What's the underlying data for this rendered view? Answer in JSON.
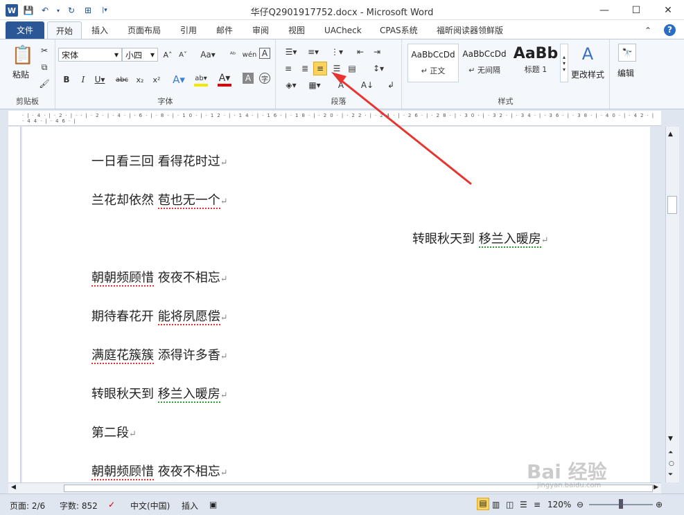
{
  "window": {
    "title": "华仔Q2901917752.docx - Microsoft Word",
    "app_icon_letter": "W"
  },
  "tabs": [
    "文件",
    "开始",
    "插入",
    "页面布局",
    "引用",
    "邮件",
    "审阅",
    "视图",
    "UACheck",
    "CPAS系统",
    "福昕阅读器领鲜版"
  ],
  "active_tab": "开始",
  "ribbon": {
    "clipboard": {
      "label": "剪贴板",
      "paste": "粘贴"
    },
    "font": {
      "label": "字体",
      "font_name": "宋体",
      "font_size": "小四"
    },
    "paragraph": {
      "label": "段落",
      "selected": "align-right"
    },
    "styles": {
      "label": "样式",
      "items": [
        {
          "preview": "AaBbCcDd",
          "name": "↵ 正文"
        },
        {
          "preview": "AaBbCcDd",
          "name": "↵ 无间隔"
        },
        {
          "preview": "AaBb",
          "name": "标题 1"
        }
      ],
      "change": "更改样式"
    },
    "editing": {
      "label": "编辑"
    }
  },
  "document": {
    "lines": [
      {
        "t1": "一日看三回",
        "t2": "看得花时过",
        "align": "left"
      },
      {
        "t1": "兰花却依然",
        "t2": "苞也无一个",
        "align": "left"
      },
      {
        "t1": "转眼秋天到",
        "t2": "移兰入暖房",
        "align": "right"
      },
      {
        "t1": "朝朝频顾惜",
        "t2": "夜夜不相忘",
        "align": "left"
      },
      {
        "t1": "期待春花开",
        "t2": "能将夙愿偿",
        "align": "left"
      },
      {
        "t1": "满庭花簇簇",
        "t2": "添得许多香",
        "align": "left"
      },
      {
        "t1": "转眼秋天到",
        "t2": "移兰入暖房",
        "align": "left"
      },
      {
        "t1": "第二段",
        "t2": "",
        "align": "left"
      },
      {
        "t1": "朝朝频顾惜",
        "t2": "夜夜不相忘",
        "align": "left"
      }
    ],
    "para_mark": "↵"
  },
  "status": {
    "page": "页面: 2/6",
    "words": "字数: 852",
    "lang": "中文(中国)",
    "mode": "插入",
    "zoom": "120%"
  },
  "watermark": {
    "text": "Bai 经验",
    "url": "jingyan.baidu.com"
  },
  "colors": {
    "file_tab": "#2b5797",
    "selected_button": "#fbd45e",
    "arrow": "#e8342e"
  }
}
